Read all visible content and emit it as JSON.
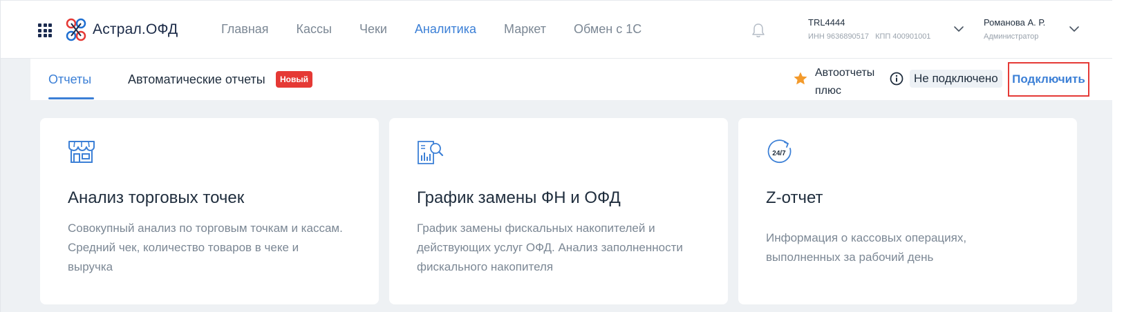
{
  "header": {
    "logo_text": "Астрал.ОФД",
    "nav": [
      {
        "label": "Главная",
        "active": false
      },
      {
        "label": "Кассы",
        "active": false
      },
      {
        "label": "Чеки",
        "active": false
      },
      {
        "label": "Аналитика",
        "active": true
      },
      {
        "label": "Маркет",
        "active": false
      },
      {
        "label": "Обмен с 1С",
        "active": false
      }
    ],
    "org": {
      "name": "TRL4444",
      "inn": "ИНН 9636890517",
      "kpp": "КПП 400901001"
    },
    "user": {
      "name": "Романова А. Р.",
      "role": "Администратор"
    }
  },
  "subnav": {
    "tabs": [
      {
        "label": "Отчеты",
        "active": true
      },
      {
        "label": "Автоматические отчеты",
        "active": false
      }
    ],
    "new_badge": "Новый",
    "autoreports_line1": "Автоотчеты",
    "autoreports_line2": "плюс",
    "status": "Не подключено",
    "connect_label": "Подключить"
  },
  "cards": [
    {
      "icon": "store-icon",
      "title": "Анализ торговых точек",
      "description": "Совокупный анализ по торговым точкам и кассам. Средний чек, количество товаров в чеке и выручка"
    },
    {
      "icon": "report-search-icon",
      "title": "График замены ФН и ОФД",
      "description": "График замены фискальных накопителей и действующих услуг ОФД. Анализ заполненности фискального накопителя"
    },
    {
      "icon": "clock-24-7-icon",
      "title": "Z-отчет",
      "description": "Информация о кассовых операциях, выполненных за рабочий день",
      "icon_text": "24/7"
    }
  ],
  "colors": {
    "accent": "#3b7fd6",
    "badge": "#e53935",
    "star": "#f39a2b",
    "background": "#eef1f4"
  }
}
